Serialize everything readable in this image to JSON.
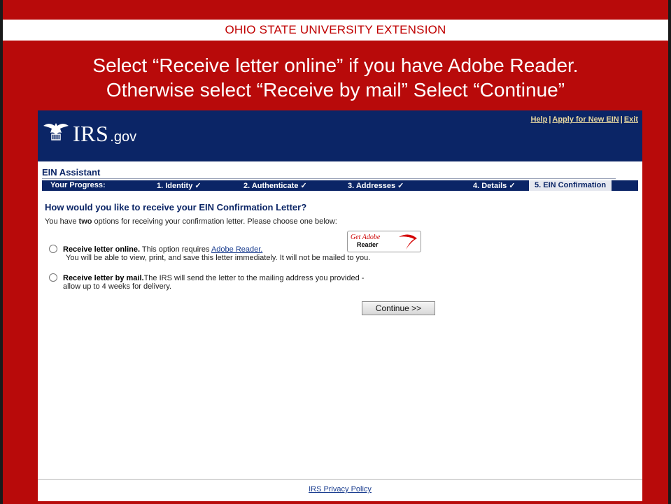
{
  "slide": {
    "header_title": "OHIO STATE UNIVERSITY EXTENSION",
    "heading_line1": "Select “Receive letter online” if you have Adobe Reader.",
    "heading_line2": "Otherwise select “Receive by mail” Select “Continue”"
  },
  "irs": {
    "logo_text": "IRS",
    "logo_suffix": ".gov",
    "top_links": [
      "Help",
      "Apply for New EIN",
      "Exit"
    ],
    "section_title": "EIN Assistant",
    "progress": {
      "label": "Your Progress:",
      "steps": [
        "1. Identity ✓",
        "2. Authenticate ✓",
        "3. Addresses ✓",
        "4. Details ✓",
        "5. EIN Confirmation"
      ]
    },
    "question": "How would you like to receive your EIN Confirmation Letter?",
    "intro_pre": "You have ",
    "intro_bold": "two",
    "intro_post": " options for receiving your confirmation letter. Please choose one below:",
    "option_online": {
      "title": "Receive letter online.",
      "text": " This option requires ",
      "link": "Adobe Reader.",
      "subtext": "You will be able to view, print, and save this letter immediately. It will not be mailed to you."
    },
    "adobe_badge": {
      "get": "Get Adobe",
      "reader": "Reader"
    },
    "option_mail": {
      "title": "Receive letter by mail.",
      "text": "The IRS will send the letter to the mailing address you provided -",
      "subtext": "allow up to 4 weeks for delivery."
    },
    "continue_label": "Continue >>",
    "footer_link": "IRS Privacy Policy"
  }
}
